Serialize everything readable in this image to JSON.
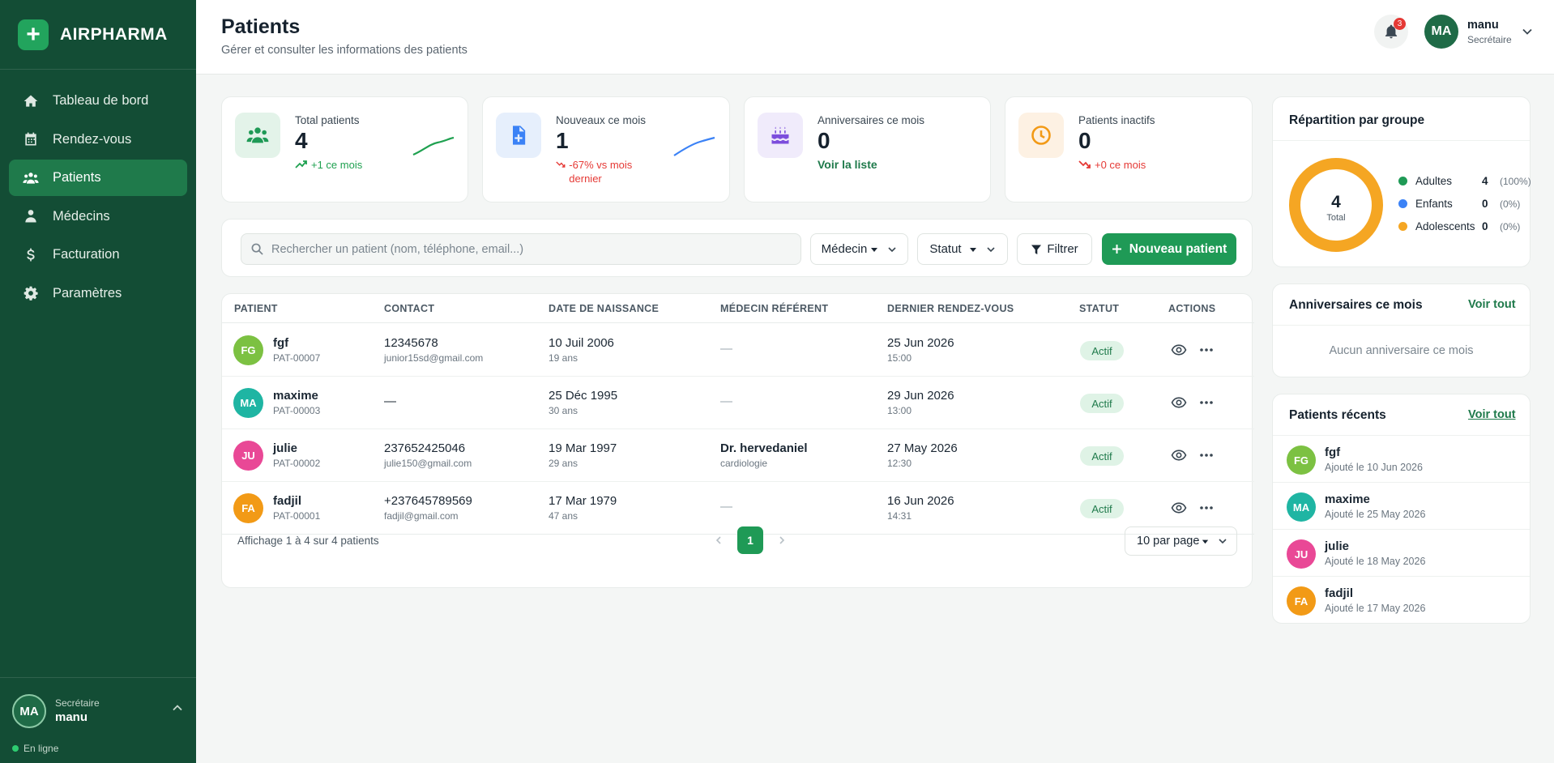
{
  "app": {
    "name": "AIRPHARMA",
    "logo_symbol": "+"
  },
  "colors": {
    "sidebar": "#134d35",
    "accent": "#1f9a56",
    "active_nav": "#1f7a4b",
    "danger": "#e53935",
    "success_text": "#1fa150"
  },
  "nav": [
    {
      "label": "Tableau de bord",
      "icon": "home-icon"
    },
    {
      "label": "Rendez-vous",
      "icon": "calendar-icon"
    },
    {
      "label": "Patients",
      "icon": "users-icon",
      "active": true
    },
    {
      "label": "Médecins",
      "icon": "doctor-icon"
    },
    {
      "label": "Facturation",
      "icon": "dollar-icon"
    },
    {
      "label": "Paramètres",
      "icon": "gear-icon"
    }
  ],
  "sidebar_user": {
    "initials": "MA",
    "role": "Secrétaire",
    "name": "manu",
    "status": "En ligne"
  },
  "header": {
    "title": "Patients",
    "subtitle": "Gérer et consulter les informations des patients",
    "notifications": "3",
    "user": {
      "initials": "MA",
      "name": "manu",
      "role": "Secrétaire"
    }
  },
  "stats": [
    {
      "label": "Total patients",
      "value": "4",
      "delta": "+1 ce mois",
      "trend": "up",
      "icon": "users-icon"
    },
    {
      "label": "Nouveaux ce mois",
      "value": "1",
      "delta": "-67% vs mois dernier",
      "trend": "down",
      "icon": "file-plus-icon"
    },
    {
      "label": "Anniversaires ce mois",
      "value": "0",
      "link": "Voir la liste",
      "icon": "cake-icon"
    },
    {
      "label": "Patients inactifs",
      "value": "0",
      "delta": "+0 ce mois",
      "trend": "down",
      "icon": "clock-icon"
    }
  ],
  "toolbar": {
    "search_placeholder": "Rechercher un patient (nom, téléphone, email...)",
    "doctor_filter": "Médecin",
    "status_filter": "Statut",
    "filter_label": "Filtrer",
    "new_patient_label": "Nouveau patient"
  },
  "table": {
    "headers": [
      "PATIENT",
      "CONTACT",
      "DATE DE NAISSANCE",
      "MÉDECIN RÉFÉRENT",
      "DERNIER RENDEZ-VOUS",
      "STATUT",
      "ACTIONS"
    ],
    "rows": [
      {
        "initials": "FG",
        "color": "#7cc142",
        "name": "fgf",
        "id": "PAT-00007",
        "phone": "12345678",
        "email": "junior15sd@gmail.com",
        "birth": "10 Juil 2006",
        "age": "19 ans",
        "doctor": "—",
        "specialty": "",
        "last_date": "25 Jun 2026",
        "last_time": "15:00",
        "status": "Actif"
      },
      {
        "initials": "MA",
        "color": "#1fb5a3",
        "name": "maxime",
        "id": "PAT-00003",
        "phone": "—",
        "email": "",
        "birth": "25 Déc 1995",
        "age": "30 ans",
        "doctor": "—",
        "specialty": "",
        "last_date": "29 Jun 2026",
        "last_time": "13:00",
        "status": "Actif"
      },
      {
        "initials": "JU",
        "color": "#e94896",
        "name": "julie",
        "id": "PAT-00002",
        "phone": "237652425046",
        "email": "julie150@gmail.com",
        "birth": "19 Mar 1997",
        "age": "29 ans",
        "doctor": "Dr. hervedaniel",
        "specialty": "cardiologie",
        "last_date": "27 May 2026",
        "last_time": "12:30",
        "status": "Actif"
      },
      {
        "initials": "FA",
        "color": "#f29a16",
        "name": "fadjil",
        "id": "PAT-00001",
        "phone": "+237645789569",
        "email": "fadjil@gmail.com",
        "birth": "17 Mar 1979",
        "age": "47 ans",
        "doctor": "—",
        "specialty": "",
        "last_date": "16 Jun 2026",
        "last_time": "14:31",
        "status": "Actif"
      }
    ],
    "footer_info": "Affichage 1 à 4 sur 4 patients",
    "current_page": "1",
    "per_page": "10 par page"
  },
  "distribution": {
    "title": "Répartition par groupe",
    "total": "4",
    "total_label": "Total",
    "groups": [
      {
        "name": "Adultes",
        "value": "4",
        "pct": "(100%)",
        "color": "#1f9a56"
      },
      {
        "name": "Enfants",
        "value": "0",
        "pct": "(0%)",
        "color": "#3b82f6"
      },
      {
        "name": "Adolescents",
        "value": "0",
        "pct": "(0%)",
        "color": "#f5a623"
      }
    ]
  },
  "birthdays": {
    "title": "Anniversaires ce mois",
    "link": "Voir tout",
    "empty": "Aucun anniversaire ce mois"
  },
  "recent": {
    "title": "Patients récents",
    "link": "Voir tout",
    "items": [
      {
        "initials": "FG",
        "color": "#7cc142",
        "name": "fgf",
        "date": "Ajouté le 10 Jun 2026"
      },
      {
        "initials": "MA",
        "color": "#1fb5a3",
        "name": "maxime",
        "date": "Ajouté le 25 May 2026"
      },
      {
        "initials": "JU",
        "color": "#e94896",
        "name": "julie",
        "date": "Ajouté le 18 May 2026"
      },
      {
        "initials": "FA",
        "color": "#f29a16",
        "name": "fadjil",
        "date": "Ajouté le 17 May 2026"
      }
    ]
  }
}
